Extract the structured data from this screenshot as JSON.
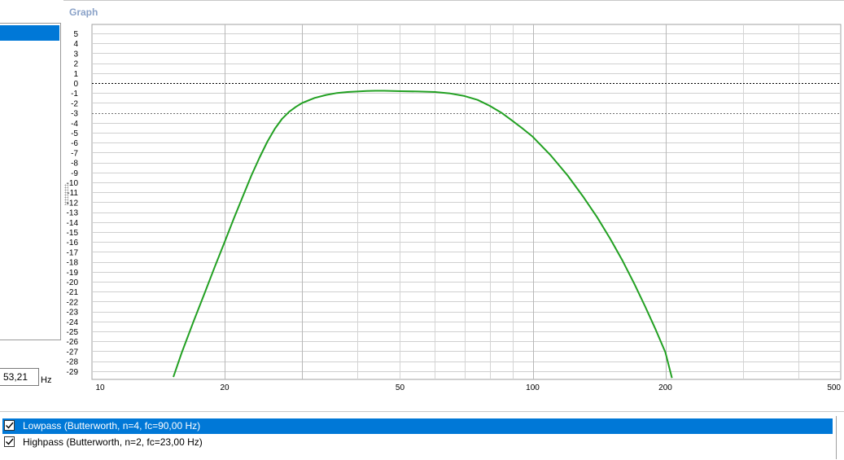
{
  "graph": {
    "title": "Graph"
  },
  "left_panel": {
    "frequency_value": "53,21",
    "frequency_unit": "Hz"
  },
  "filters": [
    {
      "label": "Lowpass (Butterworth, n=4, fc=90,00 Hz)",
      "checked": true,
      "selected": true
    },
    {
      "label": "Highpass (Butterworth, n=2, fc=23,00 Hz)",
      "checked": true,
      "selected": false
    }
  ],
  "chart_data": {
    "type": "line",
    "x_scale": "log",
    "xlim": [
      10,
      500
    ],
    "ylim": [
      -30,
      5.5
    ],
    "x_tick_labels": [
      "10",
      "20",
      "50",
      "100",
      "200",
      "500"
    ],
    "x_tick_values": [
      10,
      20,
      50,
      100,
      200,
      500
    ],
    "y_ticks": [
      5,
      4,
      3,
      2,
      1,
      0,
      -1,
      -2,
      -3,
      -4,
      -5,
      -6,
      -7,
      -8,
      -9,
      -10,
      -11,
      -12,
      -13,
      -14,
      -15,
      -16,
      -17,
      -18,
      -19,
      -20,
      -21,
      -22,
      -23,
      -24,
      -25,
      -26,
      -27,
      -28,
      -29
    ],
    "reference_lines": [
      0,
      -3
    ],
    "series": [
      {
        "color": "#22a022",
        "x": [
          15.3,
          16,
          17,
          18,
          19,
          20,
          21,
          22,
          23,
          24,
          25,
          26,
          27,
          28,
          29,
          30,
          32,
          34,
          36,
          38,
          40,
          42,
          44,
          46,
          48,
          50,
          55,
          60,
          65,
          70,
          75,
          80,
          85,
          90,
          95,
          100,
          110,
          120,
          130,
          140,
          150,
          160,
          170,
          180,
          190,
          200,
          207
        ],
        "y": [
          -29.6,
          -27.1,
          -24.0,
          -21.2,
          -18.5,
          -16.0,
          -13.6,
          -11.4,
          -9.3,
          -7.5,
          -5.9,
          -4.6,
          -3.6,
          -2.9,
          -2.4,
          -2.0,
          -1.5,
          -1.2,
          -1.0,
          -0.9,
          -0.85,
          -0.8,
          -0.78,
          -0.78,
          -0.8,
          -0.82,
          -0.85,
          -0.9,
          -1.05,
          -1.3,
          -1.7,
          -2.3,
          -3.0,
          -3.8,
          -4.6,
          -5.4,
          -7.3,
          -9.3,
          -11.4,
          -13.5,
          -15.7,
          -17.9,
          -20.2,
          -22.5,
          -24.8,
          -27.1,
          -29.7
        ]
      }
    ]
  }
}
